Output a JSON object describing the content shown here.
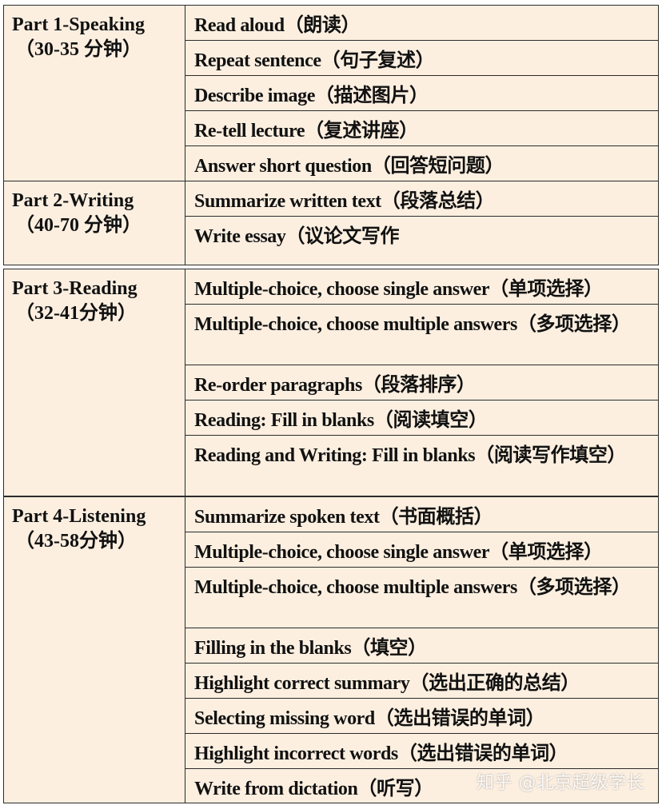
{
  "tables": [
    {
      "sections": [
        {
          "name": "Part 1-Speaking",
          "duration": "（30-35 分钟）",
          "items": [
            "Read aloud（朗读）",
            "Repeat sentence（句子复述）",
            "Describe image（描述图片）",
            "Re-tell lecture（复述讲座）",
            "Answer short question（回答短问题）"
          ]
        },
        {
          "name": "Part 2-Writing",
          "duration": "（40-70 分钟）",
          "items": [
            "Summarize written text（段落总结）",
            "Write essay（议论文写作"
          ]
        }
      ]
    },
    {
      "sections": [
        {
          "name": "Part 3-Reading",
          "duration": "（32-41分钟）",
          "items": [
            "Multiple-choice, choose single answer（单项选择）",
            "Multiple-choice, choose multiple answers（多项选择）",
            "Re-order paragraphs（段落排序）",
            "Reading: Fill in blanks（阅读填空）",
            "Reading and Writing: Fill in blanks（阅读写作填空）"
          ]
        }
      ]
    },
    {
      "sections": [
        {
          "name": "Part 4-Listening",
          "duration": "（43-58分钟）",
          "items": [
            "Summarize spoken text（书面概括）",
            "Multiple-choice, choose single answer（单项选择）",
            "Multiple-choice, choose multiple answers（多项选择）",
            "Filling in the blanks（填空）",
            "Highlight correct summary（选出正确的总结）",
            "Selecting missing word（选出错误的单词）",
            "Highlight incorrect words（选出错误的单词）",
            "Write from dictation（听写）"
          ]
        }
      ]
    }
  ],
  "watermark": "知乎 @北京超级学长"
}
